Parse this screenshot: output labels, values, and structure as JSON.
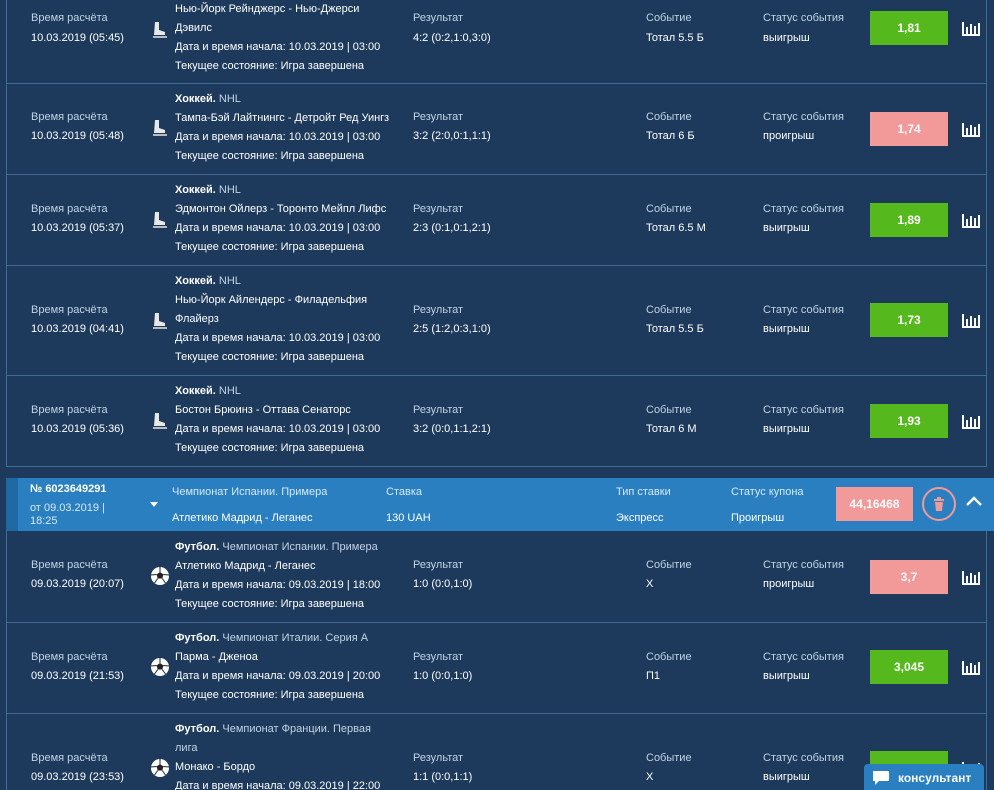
{
  "labels": {
    "calc_time": "Время расчёта",
    "start_prefix": "Дата и время начала: ",
    "state_prefix": "Текущее состояние: ",
    "result": "Результат",
    "event": "Событие",
    "event_status": "Статус события"
  },
  "bets": [
    {
      "calc_time": "10.03.2019 (05:45)",
      "sport": "",
      "league": "",
      "teams_line1": "Нью-Йорк Рейнджерс - Нью-Джерси",
      "teams_line2": "Дэвилс",
      "start": "10.03.2019 | 03:00",
      "state": "Игра завершена",
      "result": "4:2 (0:2,1:0,3:0)",
      "event": "Тотал 5.5 Б",
      "status": "выигрыш",
      "odds": "1,81",
      "outcome": "win",
      "sport_icon": "hockey-skate-icon"
    },
    {
      "calc_time": "10.03.2019 (05:48)",
      "sport": "Хоккей.",
      "league": " NHL",
      "teams_line1": "Тампа-Бэй Лайтнингс - Детройт Ред Уингз",
      "teams_line2": "",
      "start": "10.03.2019 | 03:00",
      "state": "Игра завершена",
      "result": "3:2 (2:0,0:1,1:1)",
      "event": "Тотал 6 Б",
      "status": "проигрыш",
      "odds": "1,74",
      "outcome": "lose",
      "sport_icon": "hockey-skate-icon"
    },
    {
      "calc_time": "10.03.2019 (05:37)",
      "sport": "Хоккей.",
      "league": " NHL",
      "teams_line1": "Эдмонтон Ойлерз - Торонто Мейпл Лифс",
      "teams_line2": "",
      "start": "10.03.2019 | 03:00",
      "state": "Игра завершена",
      "result": "2:3 (0:1,0:1,2:1)",
      "event": "Тотал 6.5 М",
      "status": "выигрыш",
      "odds": "1,89",
      "outcome": "win",
      "sport_icon": "hockey-skate-icon"
    },
    {
      "calc_time": "10.03.2019 (04:41)",
      "sport": "Хоккей.",
      "league": " NHL",
      "teams_line1": "Нью-Йорк Айлендерс - Филадельфия",
      "teams_line2": "Флайерз",
      "start": "10.03.2019 | 03:00",
      "state": "Игра завершена",
      "result": "2:5 (1:2,0:3,1:0)",
      "event": "Тотал 5.5 Б",
      "status": "выигрыш",
      "odds": "1,73",
      "outcome": "win",
      "sport_icon": "hockey-skate-icon"
    },
    {
      "calc_time": "10.03.2019 (05:36)",
      "sport": "Хоккей.",
      "league": " NHL",
      "teams_line1": "Бостон Брюинз - Оттава Сенаторс",
      "teams_line2": "",
      "start": "10.03.2019 | 03:00",
      "state": "Игра завершена",
      "result": "3:2 (0:0,1:1,2:1)",
      "event": "Тотал 6 М",
      "status": "выигрыш",
      "odds": "1,93",
      "outcome": "win",
      "sport_icon": "hockey-skate-icon"
    }
  ],
  "coupon": {
    "number": "№ 6023649291",
    "date": "от 09.03.2019 | 18:25",
    "championship_label": "Чемпионат Испании. Примера",
    "match": "Атлетико Мадрид - Леганес",
    "stake_label": "Ставка",
    "stake": "130 UAH",
    "type_label": "Тип ставки",
    "type": "Экспресс",
    "status_label": "Статус купона",
    "status": "Проигрыш",
    "odds": "44,16468"
  },
  "coupon_bets": [
    {
      "calc_time": "09.03.2019 (20:07)",
      "sport": "Футбол.",
      "league": " Чемпионат Испании. Примера",
      "league_line2": "",
      "teams": "Атлетико Мадрид - Леганес",
      "start": "09.03.2019 | 18:00",
      "state": "Игра завершена",
      "result": "1:0 (0:0,1:0)",
      "event": "X",
      "status": "проигрыш",
      "odds": "3,7",
      "outcome": "lose",
      "sport_icon": "soccer-ball-icon"
    },
    {
      "calc_time": "09.03.2019 (21:53)",
      "sport": "Футбол.",
      "league": " Чемпионат Италии. Серия А",
      "league_line2": "",
      "teams": "Парма - Дженоа",
      "start": "09.03.2019 | 20:00",
      "state": "Игра завершена",
      "result": "1:0 (0:0,1:0)",
      "event": "П1",
      "status": "выигрыш",
      "odds": "3,045",
      "outcome": "win",
      "sport_icon": "soccer-ball-icon"
    },
    {
      "calc_time": "09.03.2019 (23:53)",
      "sport": "Футбол.",
      "league": " Чемпионат Франции. Первая",
      "league_line2": "лига",
      "teams": "Монако - Бордо",
      "start": "09.03.2019 | 22:00",
      "state": "",
      "result": "1:1 (0:0,1:1)",
      "event": "X",
      "status": "выигрыш",
      "odds": "",
      "outcome": "win",
      "sport_icon": "soccer-ball-icon"
    }
  ],
  "consultant": "консультант",
  "colors": {
    "win": "#55b81c",
    "lose": "#f29999",
    "bg": "#1d3a5c",
    "coupon": "#2a7fc1"
  }
}
